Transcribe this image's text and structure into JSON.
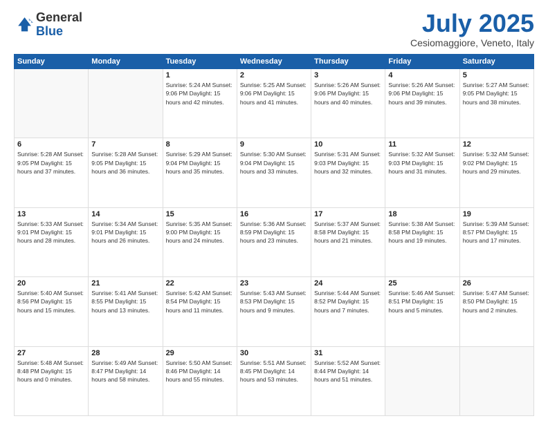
{
  "header": {
    "logo_general": "General",
    "logo_blue": "Blue",
    "month_title": "July 2025",
    "location": "Cesiomaggiore, Veneto, Italy"
  },
  "days_of_week": [
    "Sunday",
    "Monday",
    "Tuesday",
    "Wednesday",
    "Thursday",
    "Friday",
    "Saturday"
  ],
  "weeks": [
    [
      {
        "day": "",
        "detail": ""
      },
      {
        "day": "",
        "detail": ""
      },
      {
        "day": "1",
        "detail": "Sunrise: 5:24 AM\nSunset: 9:06 PM\nDaylight: 15 hours\nand 42 minutes."
      },
      {
        "day": "2",
        "detail": "Sunrise: 5:25 AM\nSunset: 9:06 PM\nDaylight: 15 hours\nand 41 minutes."
      },
      {
        "day": "3",
        "detail": "Sunrise: 5:26 AM\nSunset: 9:06 PM\nDaylight: 15 hours\nand 40 minutes."
      },
      {
        "day": "4",
        "detail": "Sunrise: 5:26 AM\nSunset: 9:06 PM\nDaylight: 15 hours\nand 39 minutes."
      },
      {
        "day": "5",
        "detail": "Sunrise: 5:27 AM\nSunset: 9:05 PM\nDaylight: 15 hours\nand 38 minutes."
      }
    ],
    [
      {
        "day": "6",
        "detail": "Sunrise: 5:28 AM\nSunset: 9:05 PM\nDaylight: 15 hours\nand 37 minutes."
      },
      {
        "day": "7",
        "detail": "Sunrise: 5:28 AM\nSunset: 9:05 PM\nDaylight: 15 hours\nand 36 minutes."
      },
      {
        "day": "8",
        "detail": "Sunrise: 5:29 AM\nSunset: 9:04 PM\nDaylight: 15 hours\nand 35 minutes."
      },
      {
        "day": "9",
        "detail": "Sunrise: 5:30 AM\nSunset: 9:04 PM\nDaylight: 15 hours\nand 33 minutes."
      },
      {
        "day": "10",
        "detail": "Sunrise: 5:31 AM\nSunset: 9:03 PM\nDaylight: 15 hours\nand 32 minutes."
      },
      {
        "day": "11",
        "detail": "Sunrise: 5:32 AM\nSunset: 9:03 PM\nDaylight: 15 hours\nand 31 minutes."
      },
      {
        "day": "12",
        "detail": "Sunrise: 5:32 AM\nSunset: 9:02 PM\nDaylight: 15 hours\nand 29 minutes."
      }
    ],
    [
      {
        "day": "13",
        "detail": "Sunrise: 5:33 AM\nSunset: 9:01 PM\nDaylight: 15 hours\nand 28 minutes."
      },
      {
        "day": "14",
        "detail": "Sunrise: 5:34 AM\nSunset: 9:01 PM\nDaylight: 15 hours\nand 26 minutes."
      },
      {
        "day": "15",
        "detail": "Sunrise: 5:35 AM\nSunset: 9:00 PM\nDaylight: 15 hours\nand 24 minutes."
      },
      {
        "day": "16",
        "detail": "Sunrise: 5:36 AM\nSunset: 8:59 PM\nDaylight: 15 hours\nand 23 minutes."
      },
      {
        "day": "17",
        "detail": "Sunrise: 5:37 AM\nSunset: 8:58 PM\nDaylight: 15 hours\nand 21 minutes."
      },
      {
        "day": "18",
        "detail": "Sunrise: 5:38 AM\nSunset: 8:58 PM\nDaylight: 15 hours\nand 19 minutes."
      },
      {
        "day": "19",
        "detail": "Sunrise: 5:39 AM\nSunset: 8:57 PM\nDaylight: 15 hours\nand 17 minutes."
      }
    ],
    [
      {
        "day": "20",
        "detail": "Sunrise: 5:40 AM\nSunset: 8:56 PM\nDaylight: 15 hours\nand 15 minutes."
      },
      {
        "day": "21",
        "detail": "Sunrise: 5:41 AM\nSunset: 8:55 PM\nDaylight: 15 hours\nand 13 minutes."
      },
      {
        "day": "22",
        "detail": "Sunrise: 5:42 AM\nSunset: 8:54 PM\nDaylight: 15 hours\nand 11 minutes."
      },
      {
        "day": "23",
        "detail": "Sunrise: 5:43 AM\nSunset: 8:53 PM\nDaylight: 15 hours\nand 9 minutes."
      },
      {
        "day": "24",
        "detail": "Sunrise: 5:44 AM\nSunset: 8:52 PM\nDaylight: 15 hours\nand 7 minutes."
      },
      {
        "day": "25",
        "detail": "Sunrise: 5:46 AM\nSunset: 8:51 PM\nDaylight: 15 hours\nand 5 minutes."
      },
      {
        "day": "26",
        "detail": "Sunrise: 5:47 AM\nSunset: 8:50 PM\nDaylight: 15 hours\nand 2 minutes."
      }
    ],
    [
      {
        "day": "27",
        "detail": "Sunrise: 5:48 AM\nSunset: 8:48 PM\nDaylight: 15 hours\nand 0 minutes."
      },
      {
        "day": "28",
        "detail": "Sunrise: 5:49 AM\nSunset: 8:47 PM\nDaylight: 14 hours\nand 58 minutes."
      },
      {
        "day": "29",
        "detail": "Sunrise: 5:50 AM\nSunset: 8:46 PM\nDaylight: 14 hours\nand 55 minutes."
      },
      {
        "day": "30",
        "detail": "Sunrise: 5:51 AM\nSunset: 8:45 PM\nDaylight: 14 hours\nand 53 minutes."
      },
      {
        "day": "31",
        "detail": "Sunrise: 5:52 AM\nSunset: 8:44 PM\nDaylight: 14 hours\nand 51 minutes."
      },
      {
        "day": "",
        "detail": ""
      },
      {
        "day": "",
        "detail": ""
      }
    ]
  ]
}
